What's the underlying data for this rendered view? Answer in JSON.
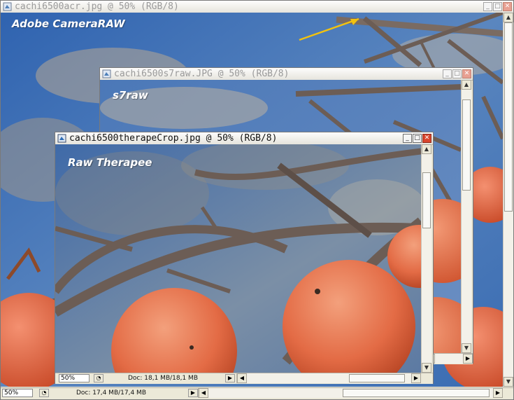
{
  "colors": {
    "sky": "#3e6fb0",
    "fruit": "#e36b45",
    "branch": "#6c5d55",
    "arrow": "#f2c20f"
  },
  "windows": {
    "acr": {
      "title": "cachi6500acr.jpg @ 50% (RGB/8)",
      "overlay_label": "Adobe CameraRAW",
      "zoom": "50%",
      "doc_info": "Doc: 17,4 MB/17,4 MB"
    },
    "s7": {
      "title": "cachi6500s7raw.JPG @ 50% (RGB/8)",
      "overlay_label": "s7raw"
    },
    "therapee": {
      "title": "cachi6500therapeCrop.jpg @ 50% (RGB/8)",
      "overlay_label": "Raw Therapee",
      "zoom": "50%",
      "doc_info": "Doc: 18,1 MB/18,1 MB"
    }
  },
  "titlebar_buttons": {
    "minimize": "_",
    "maximize": "□",
    "close": "✕"
  },
  "scroll_glyphs": {
    "up": "▲",
    "down": "▼",
    "left": "◀",
    "right": "▶"
  },
  "icons": [
    "photoshop-doc-icon",
    "minimize-icon",
    "maximize-icon",
    "close-icon",
    "arrow-annotation-icon"
  ]
}
